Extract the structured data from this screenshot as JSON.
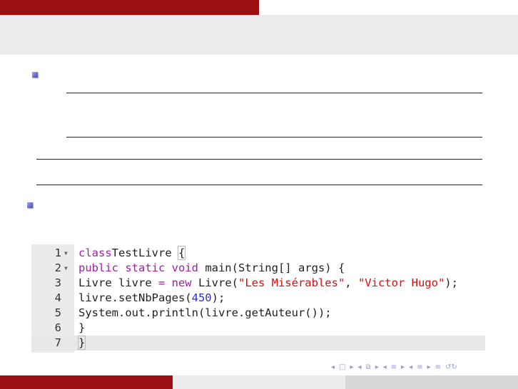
{
  "editor": {
    "lines": [
      {
        "number": "1",
        "fold": "▼",
        "code": [
          [
            "kw",
            "class"
          ],
          [
            "",
            "TestLivre "
          ],
          [
            "bracket",
            "{"
          ]
        ]
      },
      {
        "number": "2",
        "fold": "▼",
        "code": [
          [
            "kw",
            "public static void"
          ],
          [
            "",
            " main(String[] args) {"
          ]
        ]
      },
      {
        "number": "3",
        "fold": "",
        "code": [
          [
            "",
            "Livre livre "
          ],
          [
            "kw",
            "= new"
          ],
          [
            "",
            " Livre("
          ],
          [
            "str",
            "\"Les Misérables\""
          ],
          [
            "",
            ", "
          ],
          [
            "str",
            "\"Victor Hugo\""
          ],
          [
            "",
            ");"
          ]
        ]
      },
      {
        "number": "4",
        "fold": "",
        "code": [
          [
            "",
            "livre.setNbPages("
          ],
          [
            "num",
            "450"
          ],
          [
            "",
            ");"
          ]
        ]
      },
      {
        "number": "5",
        "fold": "",
        "code": [
          [
            "",
            "System.out.println(livre.getAuteur());"
          ]
        ]
      },
      {
        "number": "6",
        "fold": "",
        "code": [
          [
            "",
            "}"
          ]
        ]
      },
      {
        "number": "7",
        "fold": "",
        "code": [
          [
            "bracket",
            "}"
          ]
        ],
        "active": true
      }
    ]
  },
  "nav": {
    "frame_prev": "◂",
    "frame_icon": "□",
    "frame_next": "▸",
    "sub_prev": "◂",
    "sub_icon": "⧉",
    "sub_next": "▸",
    "sec_prev": "◂",
    "sec_icon": "≡",
    "sec_next": "▸",
    "subsec_prev": "◂",
    "subsec_icon": "≡",
    "subsec_next": "▸",
    "align_icon": "≡",
    "search_icon": "↺↻"
  },
  "colors": {
    "theme_red": "#9b0f12",
    "keyword": "#a020a0",
    "string": "#d01010",
    "number": "#3030c0",
    "bullet": "#6a6ad0"
  }
}
